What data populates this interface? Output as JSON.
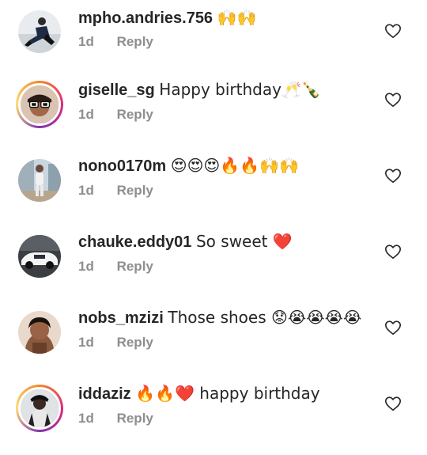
{
  "colors": {
    "text": "#262626",
    "meta": "#8e8e8e",
    "heart_outline": "#262626",
    "story_ring": "#dd2a7b"
  },
  "comments": [
    {
      "username": "mpho.andries.756",
      "text": "🙌🙌",
      "time": "1d",
      "reply_label": "Reply",
      "has_story_ring": false,
      "like_icon": "heart-outline-icon"
    },
    {
      "username": "giselle_sg",
      "text": "Happy birthday🥂🍾",
      "time": "1d",
      "reply_label": "Reply",
      "has_story_ring": true,
      "like_icon": "heart-outline-icon"
    },
    {
      "username": "nono0170m",
      "text": "😍😍😍🔥🔥🙌🙌",
      "time": "1d",
      "reply_label": "Reply",
      "has_story_ring": false,
      "like_icon": "heart-outline-icon"
    },
    {
      "username": "chauke.eddy01",
      "text": "So sweet ❤️",
      "time": "1d",
      "reply_label": "Reply",
      "has_story_ring": false,
      "like_icon": "heart-outline-icon"
    },
    {
      "username": "nobs_mzizi",
      "text": "Those shoes 😟😭😭😭😭",
      "time": "1d",
      "reply_label": "Reply",
      "has_story_ring": false,
      "like_icon": "heart-outline-icon"
    },
    {
      "username": "iddaziz",
      "text": "🔥🔥❤️ happy birthday",
      "time": "1d",
      "reply_label": "Reply",
      "has_story_ring": true,
      "like_icon": "heart-outline-icon"
    }
  ]
}
